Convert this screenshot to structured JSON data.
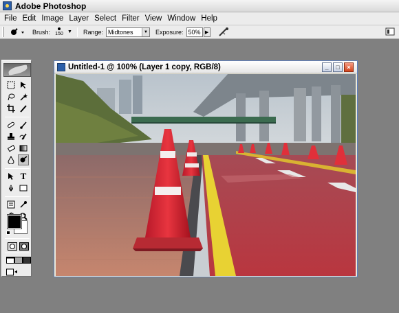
{
  "app": {
    "title": "Adobe Photoshop"
  },
  "menu": {
    "items": [
      {
        "label": "File"
      },
      {
        "label": "Edit"
      },
      {
        "label": "Image"
      },
      {
        "label": "Layer"
      },
      {
        "label": "Select"
      },
      {
        "label": "Filter"
      },
      {
        "label": "View"
      },
      {
        "label": "Window"
      },
      {
        "label": "Help"
      }
    ]
  },
  "options": {
    "brush_label": "Brush:",
    "brush_size": "150",
    "range_label": "Range:",
    "range_value": "Midtones",
    "exposure_label": "Exposure:",
    "exposure_value": "50%",
    "active_tool_icon": "burn-tool-icon",
    "airbrush_icon": "airbrush-icon",
    "palette_icon": "palette-well-icon"
  },
  "toolbox": {
    "foreground_color": "#000000",
    "background_color": "#ffffff",
    "tools": [
      "marquee-tool",
      "move-tool",
      "lasso-tool",
      "magic-wand-tool",
      "crop-tool",
      "slice-tool",
      "healing-brush-tool",
      "brush-tool",
      "clone-stamp-tool",
      "history-brush-tool",
      "eraser-tool",
      "gradient-tool",
      "blur-tool",
      "dodge-tool",
      "path-selection-tool",
      "type-tool",
      "pen-tool",
      "shape-tool",
      "notes-tool",
      "eyedropper-tool",
      "hand-tool",
      "zoom-tool"
    ]
  },
  "document": {
    "title": "Untitled-1 @ 100% (Layer 1 copy, RGB/8)",
    "minimize_label": "_",
    "maximize_label": "□",
    "close_label": "×"
  }
}
